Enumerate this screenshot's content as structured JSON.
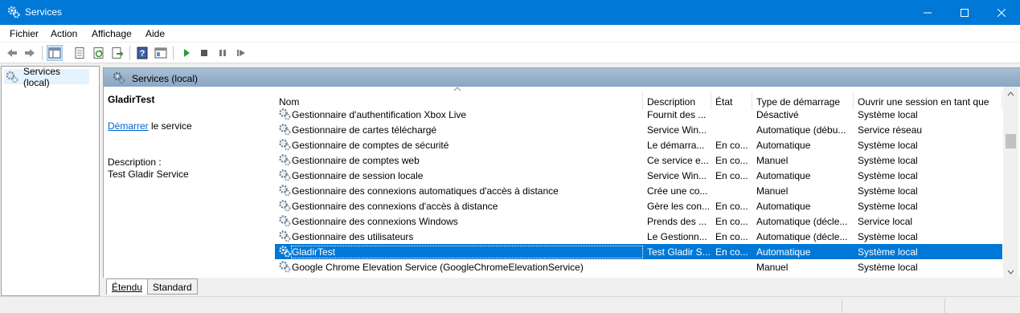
{
  "window": {
    "title": "Services"
  },
  "menu": [
    "Fichier",
    "Action",
    "Affichage",
    "Aide"
  ],
  "toolbar": {
    "icons": [
      "back-arrow-icon",
      "forward-arrow-icon",
      "show-hide-tree-icon",
      "properties-icon",
      "refresh-icon",
      "export-icon",
      "help-icon",
      "console-view-icon",
      "start-icon",
      "stop-icon",
      "pause-icon",
      "restart-icon"
    ]
  },
  "tree": {
    "node_label": "Services (local)"
  },
  "main": {
    "header_title": "Services (local)"
  },
  "details": {
    "service_name": "GladirTest",
    "start_link": "Démarrer",
    "start_suffix": " le service",
    "description_label": "Description :",
    "description_text": "Test Gladir Service"
  },
  "columns": {
    "name": "Nom",
    "description": "Description",
    "state": "État",
    "startup": "Type de démarrage",
    "logon": "Ouvrir une session en tant que"
  },
  "rows": [
    {
      "name": "Gestionnaire d'authentification Xbox Live",
      "description": "Fournit des ...",
      "state": "",
      "startup": "Désactivé",
      "logon": "Système local"
    },
    {
      "name": "Gestionnaire de cartes téléchargé",
      "description": "Service Win...",
      "state": "",
      "startup": "Automatique (débu...",
      "logon": "Service réseau"
    },
    {
      "name": "Gestionnaire de comptes de sécurité",
      "description": "Le démarra...",
      "state": "En co...",
      "startup": "Automatique",
      "logon": "Système local"
    },
    {
      "name": "Gestionnaire de comptes web",
      "description": "Ce service e...",
      "state": "En co...",
      "startup": "Manuel",
      "logon": "Système local"
    },
    {
      "name": "Gestionnaire de session locale",
      "description": "Service Win...",
      "state": "En co...",
      "startup": "Automatique",
      "logon": "Système local"
    },
    {
      "name": "Gestionnaire des connexions automatiques d'accès à distance",
      "description": "Crée une co...",
      "state": "",
      "startup": "Manuel",
      "logon": "Système local"
    },
    {
      "name": "Gestionnaire des connexions d'accès à distance",
      "description": "Gère les con...",
      "state": "En co...",
      "startup": "Automatique",
      "logon": "Système local"
    },
    {
      "name": "Gestionnaire des connexions Windows",
      "description": "Prends des ...",
      "state": "En co...",
      "startup": "Automatique (décle...",
      "logon": "Service local"
    },
    {
      "name": "Gestionnaire des utilisateurs",
      "description": "Le Gestionn...",
      "state": "En co...",
      "startup": "Automatique (décle...",
      "logon": "Système local"
    },
    {
      "name": "GladirTest",
      "description": "Test Gladir S...",
      "state": "En co...",
      "startup": "Automatique",
      "logon": "Système local",
      "selected": true
    },
    {
      "name": "Google Chrome Elevation Service (GoogleChromeElevationService)",
      "description": "",
      "state": "",
      "startup": "Manuel",
      "logon": "Système local"
    }
  ],
  "tabs": [
    "Étendu",
    "Standard"
  ],
  "colors": {
    "titlebar": "#0078d7",
    "selection": "#0078d7",
    "pane_header": "#9bb4cf"
  }
}
